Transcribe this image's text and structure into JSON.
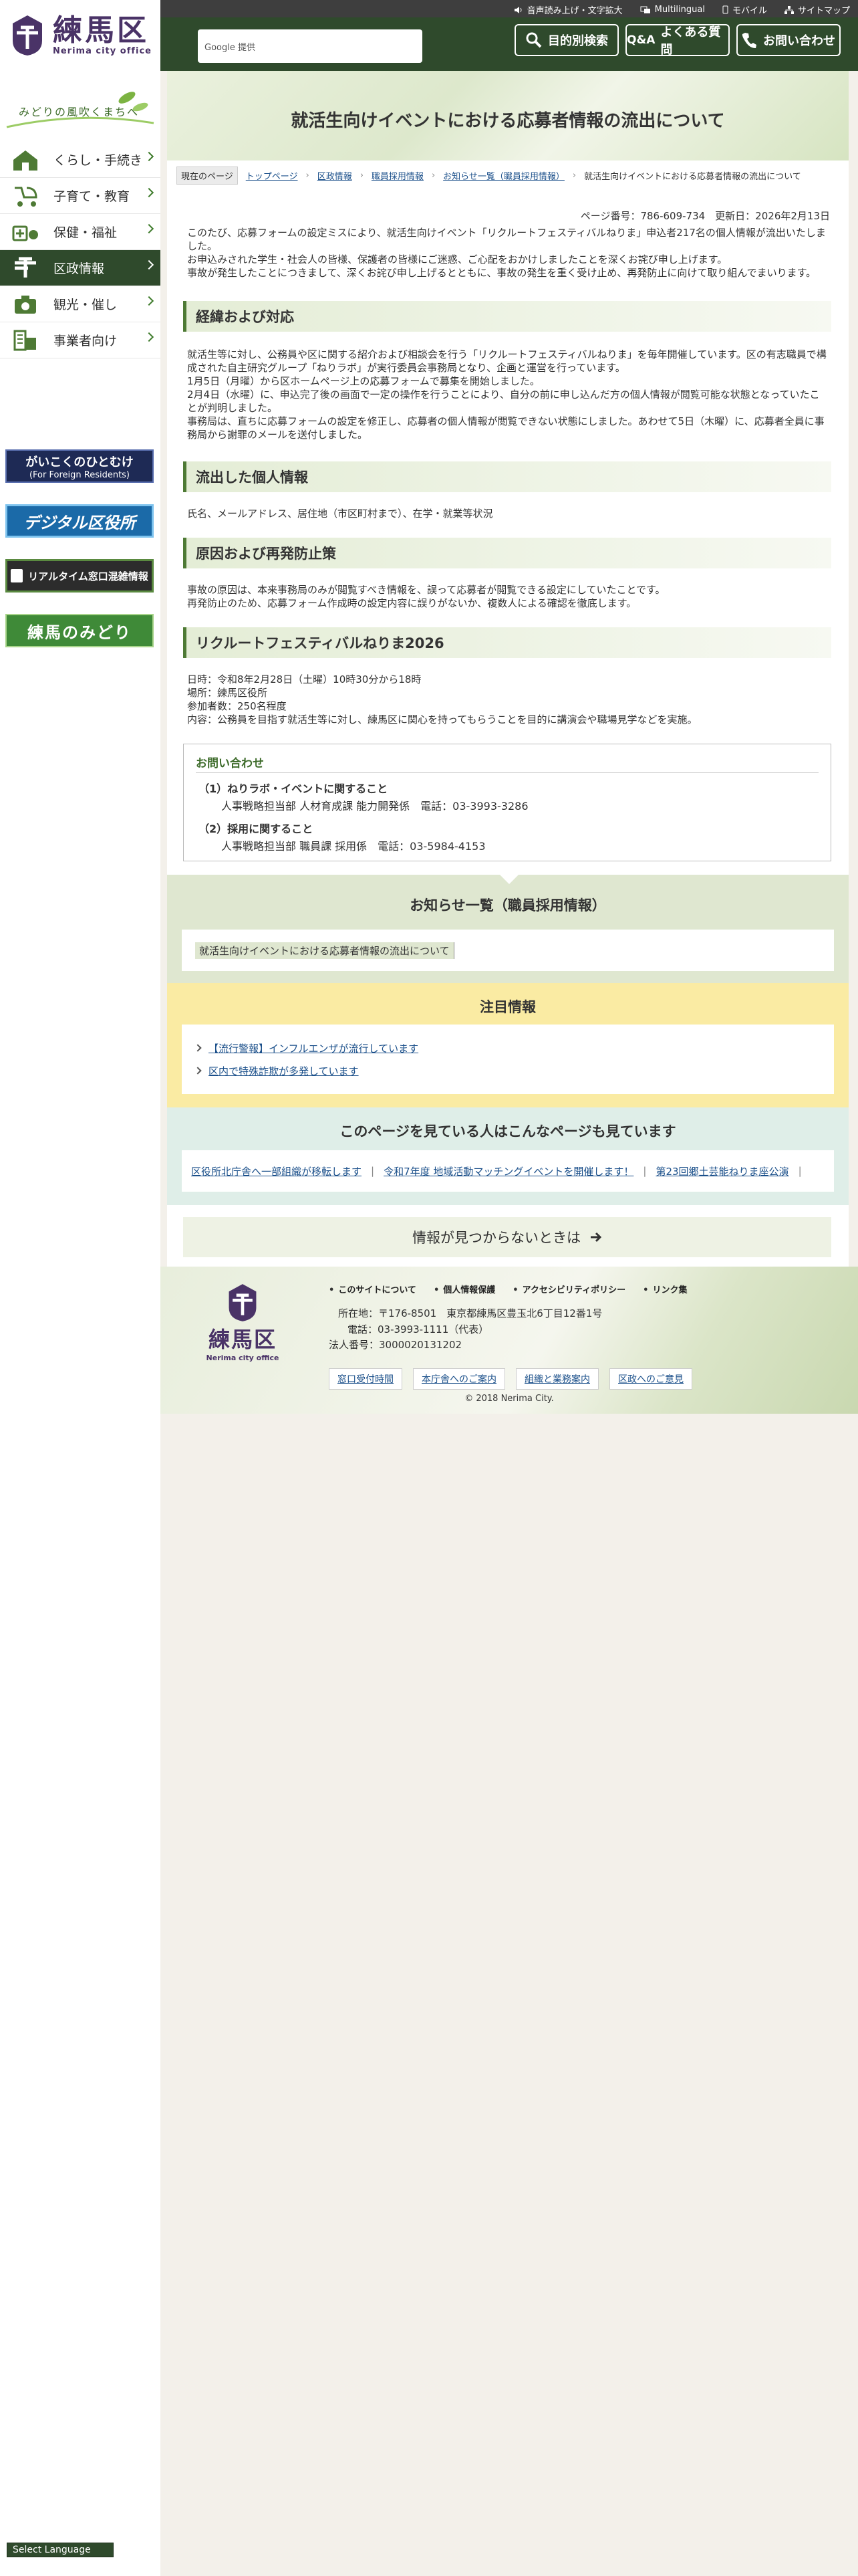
{
  "header": {
    "utility_links": [
      "音声読み上げ・文字拡大",
      "Multilingual",
      "モバイル",
      "サイトマップ"
    ],
    "logo_ja": "練馬区",
    "logo_en": "Nerima city office",
    "search_placeholder": "Google 提供",
    "buttons": {
      "purpose": "目的別検索",
      "faq": "よくある質問",
      "contact": "お問い合わせ"
    }
  },
  "sidebar": {
    "tagline": "みどりの風吹くまちへ",
    "nav": [
      {
        "label": "くらし・手続き"
      },
      {
        "label": "子育て・教育"
      },
      {
        "label": "保健・福祉"
      },
      {
        "label": "区政情報",
        "active": true
      },
      {
        "label": "観光・催し"
      },
      {
        "label": "事業者向け"
      }
    ],
    "banners": {
      "foreign": "がいこくのひとむけ",
      "foreign_sub": "(For Foreign Residents)",
      "digital": "デジタル区役所",
      "realtime": "リアルタイム窓口混雑情報",
      "green": "練馬のみどり"
    },
    "language_select": "Select Language"
  },
  "main": {
    "title": "就活生向けイベントにおける応募者情報の流出について",
    "breadcrumb": {
      "here_label": "現在のページ",
      "items": [
        "トップページ",
        "区政情報",
        "職員採用情報",
        "お知らせ一覧（職員採用情報）"
      ],
      "current": "就活生向けイベントにおける応募者情報の流出について"
    },
    "meta": "ページ番号：786-609-734　更新日：2026年2月13日",
    "intro": [
      "このたび、応募フォームの設定ミスにより、就活生向けイベント「リクルートフェスティバルねりま」申込者217名の個人情報が流出いたしました。",
      "お申込みされた学生・社会人の皆様、保護者の皆様にご迷惑、ご心配をおかけしましたことを深くお詫び申し上げます。",
      "事故が発生したことにつきまして、深くお詫び申し上げるとともに、事故の発生を重く受け止め、再発防止に向けて取り組んでまいります。"
    ],
    "sections": [
      {
        "heading": "経緯および対応",
        "lines": [
          "就活生等に対し、公務員や区に関する紹介および相談会を行う「リクルートフェスティバルねりま」を毎年開催しています。区の有志職員で構成された自主研究グループ「ねりラボ」が実行委員会事務局となり、企画と運営を行っています。",
          "1月5日（月曜）から区ホームページ上の応募フォームで募集を開始しました。",
          "2月4日（水曜）に、申込完了後の画面で一定の操作を行うことにより、自分の前に申し込んだ方の個人情報が閲覧可能な状態となっていたことが判明しました。",
          "事務局は、直ちに応募フォームの設定を修正し、応募者の個人情報が閲覧できない状態にしました。あわせて5日（木曜）に、応募者全員に事務局から謝罪のメールを送付しました。"
        ]
      },
      {
        "heading": "流出した個人情報",
        "lines": [
          "氏名、メールアドレス、居住地（市区町村まで）、在学・就業等状況"
        ]
      },
      {
        "heading": "原因および再発防止策",
        "lines": [
          "事故の原因は、本来事務局のみが閲覧すべき情報を、誤って応募者が閲覧できる設定にしていたことです。",
          "再発防止のため、応募フォーム作成時の設定内容に誤りがないか、複数人による確認を徹底します。"
        ]
      },
      {
        "heading": "リクルートフェスティバルねりま2026",
        "lines": [
          "日時：令和8年2月28日（土曜）10時30分から18時",
          "場所：練馬区役所",
          "参加者数：250名程度",
          "内容：公務員を目指す就活生等に対し、練馬区に関心を持ってもらうことを目的に講演会や職場見学などを実施。"
        ]
      }
    ],
    "contact": {
      "title": "お問い合わせ",
      "items": [
        {
          "head": "（1）ねりラボ・イベントに関すること",
          "detail": "人事戦略担当部 人材育成課 能力開発係　電話：03-3993-3286"
        },
        {
          "head": "（2）採用に関すること",
          "detail": "人事戦略担当部 職員課 採用係　電話：03-5984-4153"
        }
      ]
    }
  },
  "news": {
    "title": "お知らせ一覧（職員採用情報）",
    "items": [
      "就活生向けイベントにおける応募者情報の流出について"
    ]
  },
  "attention": {
    "title": "注目情報",
    "items": [
      "【流行警報】インフルエンザが流行しています",
      "区内で特殊詐欺が多発しています"
    ]
  },
  "related": {
    "title": "このページを見ている人はこんなページも見ています",
    "items": [
      "区役所北庁舎へ一部組織が移転します",
      "令和7年度 地域活動マッチングイベントを開催します！",
      "第23回郷土芸能ねりま座公演"
    ]
  },
  "not_found": "情報が見つからないときは",
  "footer": {
    "links": [
      "このサイトについて",
      "個人情報保護",
      "アクセシビリティポリシー",
      "リンク集"
    ],
    "address": "所在地：〒176-8501　東京都練馬区豊玉北6丁目12番1号",
    "phone": "電話：03-3993-1111（代表）",
    "corporate_number": "法人番号：3000020131202",
    "buttons": [
      "窓口受付時間",
      "本庁舎へのご案内",
      "組織と業務案内",
      "区政へのご意見"
    ],
    "copyright": "© 2018 Nerima City."
  },
  "colors": {
    "header": "#2f4a2c",
    "brand_purple": "#4a3367",
    "accent_green": "#4e7a35",
    "attention_yellow": "#faeba3"
  }
}
